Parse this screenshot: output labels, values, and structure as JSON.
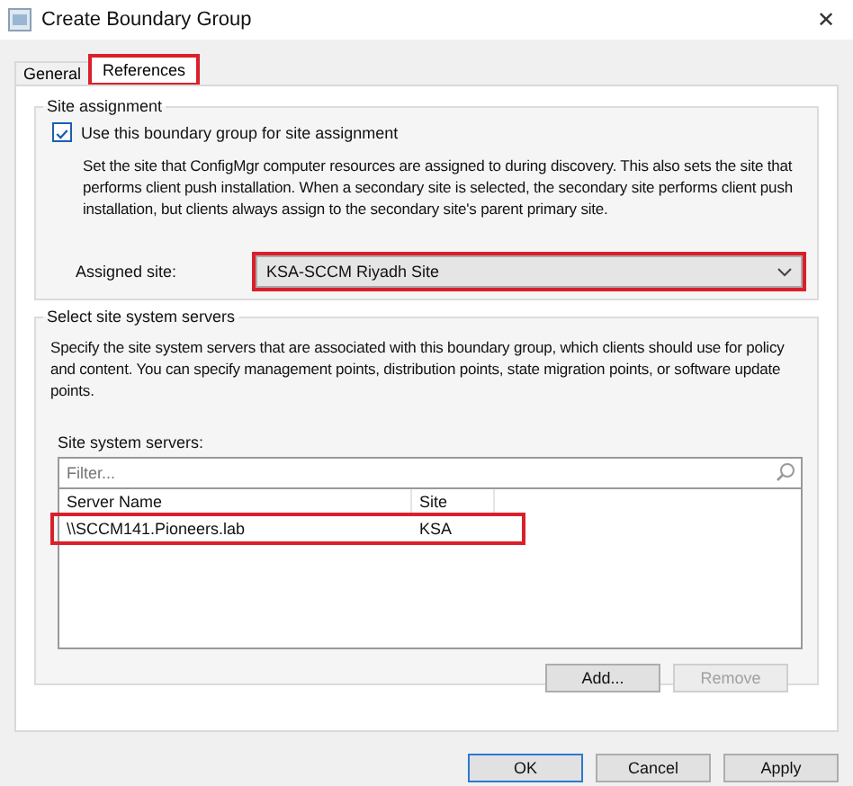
{
  "window": {
    "title": "Create Boundary Group",
    "close": "✕"
  },
  "tabs": [
    {
      "label": "General",
      "selected": false,
      "highlighted": false
    },
    {
      "label": "References",
      "selected": true,
      "highlighted": true
    }
  ],
  "site_assignment": {
    "title": "Site assignment",
    "checkbox": {
      "label": "Use this boundary group for site assignment",
      "checked": true
    },
    "description": "Set the site that ConfigMgr computer resources are assigned to during discovery. This also sets the site that performs client push installation. When a secondary site is selected, the secondary site performs client push installation, but clients always assign to the secondary site's parent primary site.",
    "assigned_site": {
      "label": "Assigned site:",
      "value": "KSA-SCCM Riyadh Site",
      "highlighted": true
    }
  },
  "site_system_servers": {
    "title": "Select site system servers",
    "description": "Specify the site system servers that are associated with this boundary group, which clients should use for policy and content. You can specify management points, distribution points, state migration points, or software update points.",
    "list_label": "Site system servers:",
    "filter": {
      "placeholder": "Filter..."
    },
    "columns": [
      "Server Name",
      "Site"
    ],
    "rows": [
      {
        "server_name": "\\\\SCCM141.Pioneers.lab",
        "site": "KSA",
        "highlighted": true
      }
    ],
    "buttons": [
      {
        "label": "Add...",
        "disabled": false
      },
      {
        "label": "Remove",
        "disabled": true
      }
    ]
  },
  "buttons": [
    {
      "label": "OK",
      "default": true
    },
    {
      "label": "Cancel",
      "default": false
    },
    {
      "label": "Apply",
      "default": false
    }
  ]
}
